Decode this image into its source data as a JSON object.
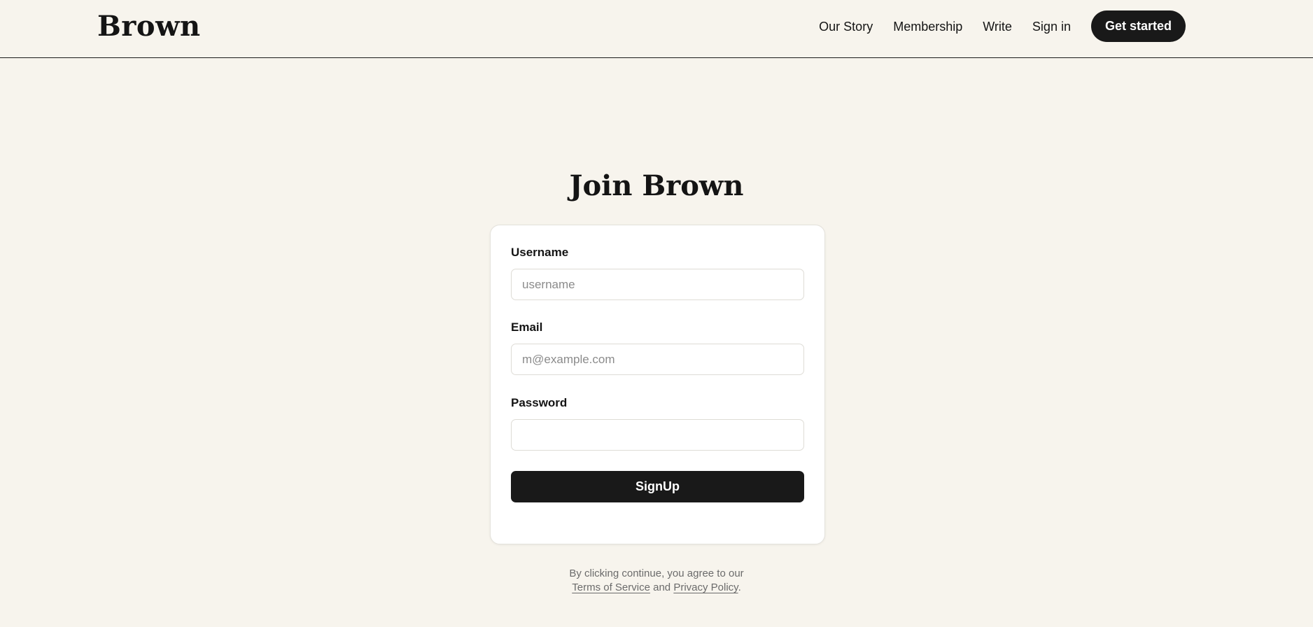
{
  "header": {
    "logo": "Brown",
    "nav": {
      "our_story": "Our Story",
      "membership": "Membership",
      "write": "Write",
      "sign_in": "Sign in"
    },
    "cta_label": "Get started"
  },
  "main": {
    "title": "Join Brown",
    "form": {
      "username": {
        "label": "Username",
        "placeholder": "username",
        "value": ""
      },
      "email": {
        "label": "Email",
        "placeholder": "m@example.com",
        "value": ""
      },
      "password": {
        "label": "Password",
        "placeholder": "",
        "value": ""
      },
      "submit_label": "SignUp"
    }
  },
  "legal": {
    "prefix": "By clicking continue, you agree to our",
    "terms": "Terms of Service",
    "and": "and",
    "privacy": "Privacy Policy",
    "suffix": "."
  },
  "colors": {
    "background": "#f7f4ed",
    "primary": "#191919",
    "card": "#ffffff"
  }
}
